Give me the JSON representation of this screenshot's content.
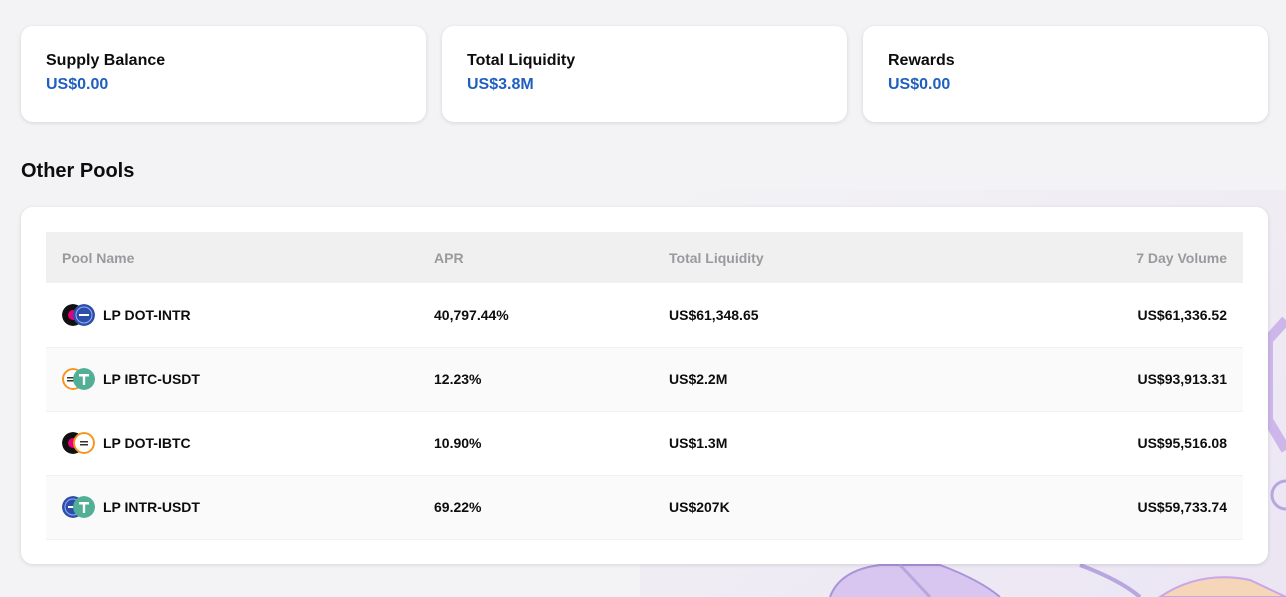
{
  "summary_cards": [
    {
      "label": "Supply Balance",
      "value": "US$0.00"
    },
    {
      "label": "Total Liquidity",
      "value": "US$3.8M"
    },
    {
      "label": "Rewards",
      "value": "US$0.00"
    }
  ],
  "other_pools": {
    "title": "Other Pools",
    "columns": [
      "Pool Name",
      "APR",
      "Total Liquidity",
      "7 Day Volume"
    ],
    "rows": [
      {
        "name": "LP DOT-INTR",
        "apr": "40,797.44%",
        "liquidity": "US$61,348.65",
        "volume": "US$61,336.52",
        "icons": [
          "dot-token-icon",
          "intr-token-icon"
        ]
      },
      {
        "name": "LP IBTC-USDT",
        "apr": "12.23%",
        "liquidity": "US$2.2M",
        "volume": "US$93,913.31",
        "icons": [
          "ibtc-token-icon",
          "usdt-token-icon"
        ]
      },
      {
        "name": "LP DOT-IBTC",
        "apr": "10.90%",
        "liquidity": "US$1.3M",
        "volume": "US$95,516.08",
        "icons": [
          "dot-token-icon",
          "ibtc-token-icon"
        ]
      },
      {
        "name": "LP INTR-USDT",
        "apr": "69.22%",
        "liquidity": "US$207K",
        "volume": "US$59,733.74",
        "icons": [
          "intr-token-icon",
          "usdt-token-icon"
        ]
      }
    ]
  },
  "colors": {
    "accent_value": "#1f5fbf",
    "header_text": "#9a9a9e",
    "background": "#f3f3f5"
  }
}
